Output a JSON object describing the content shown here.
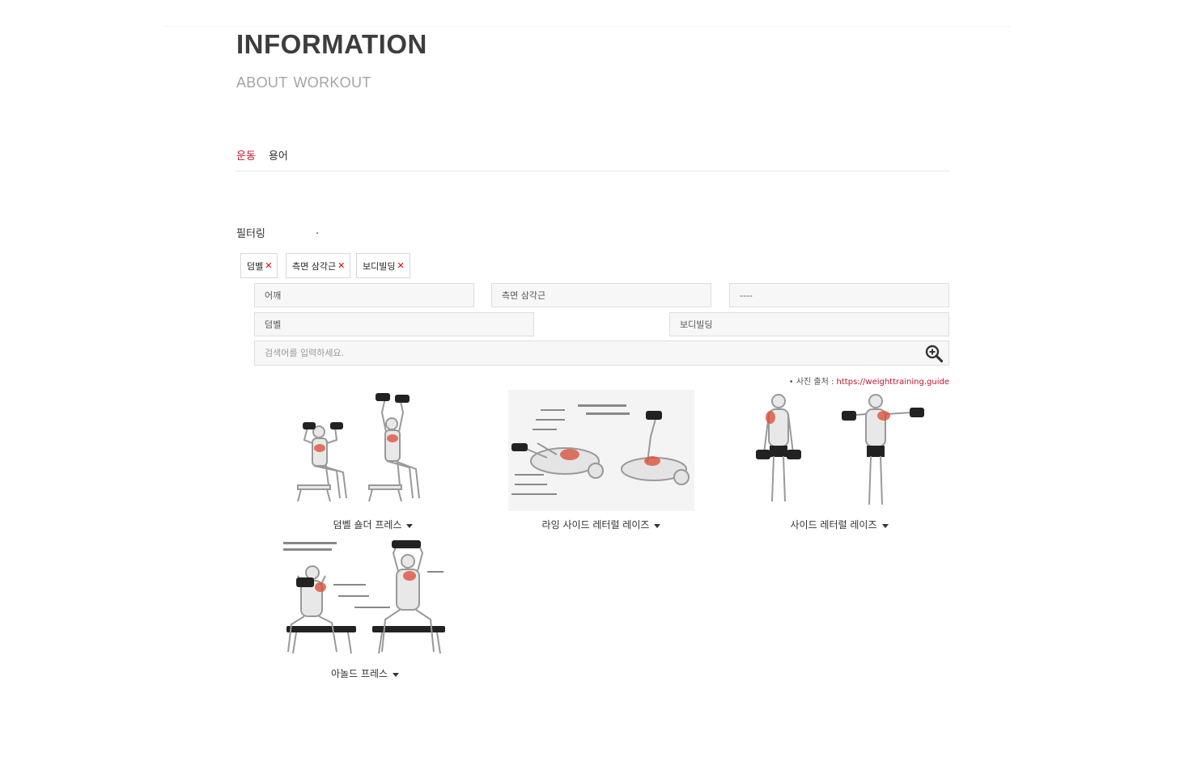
{
  "header": {
    "title": "INFORMATION",
    "subtitle": "ABOUT  WORKOUT"
  },
  "tabs": [
    {
      "label": "운동",
      "active": true
    },
    {
      "label": "용어",
      "active": false
    }
  ],
  "filter": {
    "label": "필터링",
    "dot": ".",
    "tags": [
      "덤벨",
      "측면 삼각근",
      "보디빌딩"
    ],
    "tag_remove_symbol": "✕",
    "selects": {
      "body_part": "어깨",
      "muscle": "측면 삼각근",
      "extra": "----",
      "equipment": "덤벨",
      "category": "보디빌딩"
    },
    "search_placeholder": "검색어를 입력하세요."
  },
  "source": {
    "prefix": "• 사진 출처 : ",
    "link": "https://weighttraining.guide"
  },
  "exercises": [
    {
      "name": "덤벨 숄더 프레스",
      "icon": "dumbbell-shoulder-press-illustration"
    },
    {
      "name": "라잉 사이드 레터럴 레이즈",
      "icon": "lying-side-lateral-raise-illustration"
    },
    {
      "name": "사이드 레터럴 레이즈",
      "icon": "side-lateral-raise-illustration"
    },
    {
      "name": "아놀드 프레스",
      "icon": "arnold-press-illustration"
    }
  ],
  "colors": {
    "accent": "#c8102e",
    "muscle_highlight": "#d9533f",
    "title": "#3d3d3d",
    "subtitle": "#a5a5a5"
  }
}
